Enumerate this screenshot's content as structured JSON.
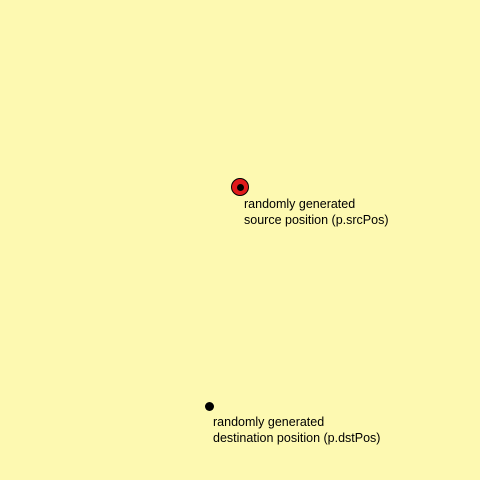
{
  "canvas": {
    "background": "#fdf9b1"
  },
  "source": {
    "marker_color": "#e01b1b",
    "marker_icon": "source-position-icon",
    "label_line1": "randomly generated",
    "label_line2": "source position (p.srcPos)"
  },
  "destination": {
    "marker_color": "#000000",
    "marker_icon": "destination-position-icon",
    "label_line1": "randomly generated",
    "label_line2": "destination position (p.dstPos)"
  }
}
